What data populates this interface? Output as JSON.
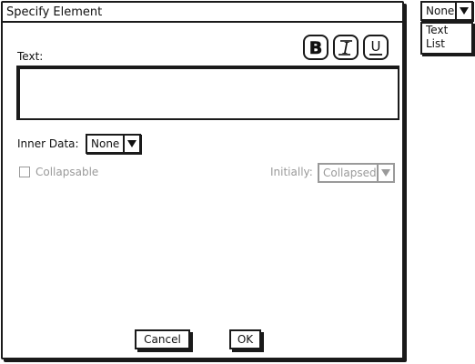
{
  "dialog": {
    "title": "Specify Element",
    "text_label": "Text:",
    "format_buttons": [
      {
        "name": "bold",
        "glyph": "B"
      },
      {
        "name": "italic",
        "glyph": "I"
      },
      {
        "name": "underline",
        "glyph": "U"
      }
    ],
    "text_value": "",
    "inner_data": {
      "label": "Inner Data:",
      "selected": "None"
    },
    "collapsable": {
      "label": "Collapsable",
      "checked": false,
      "enabled": false
    },
    "initially": {
      "label": "Initially:",
      "selected": "Collapsed",
      "enabled": false
    },
    "buttons": {
      "cancel": "Cancel",
      "ok": "OK"
    }
  },
  "side_dropdown": {
    "selected": "None",
    "options": [
      "Text",
      "List"
    ]
  },
  "icons": {
    "select_arrow": "triangle-down-icon"
  },
  "colors": {
    "ink": "#1a1a1a",
    "disabled": "#9a9a9a",
    "background": "#ffffff"
  }
}
